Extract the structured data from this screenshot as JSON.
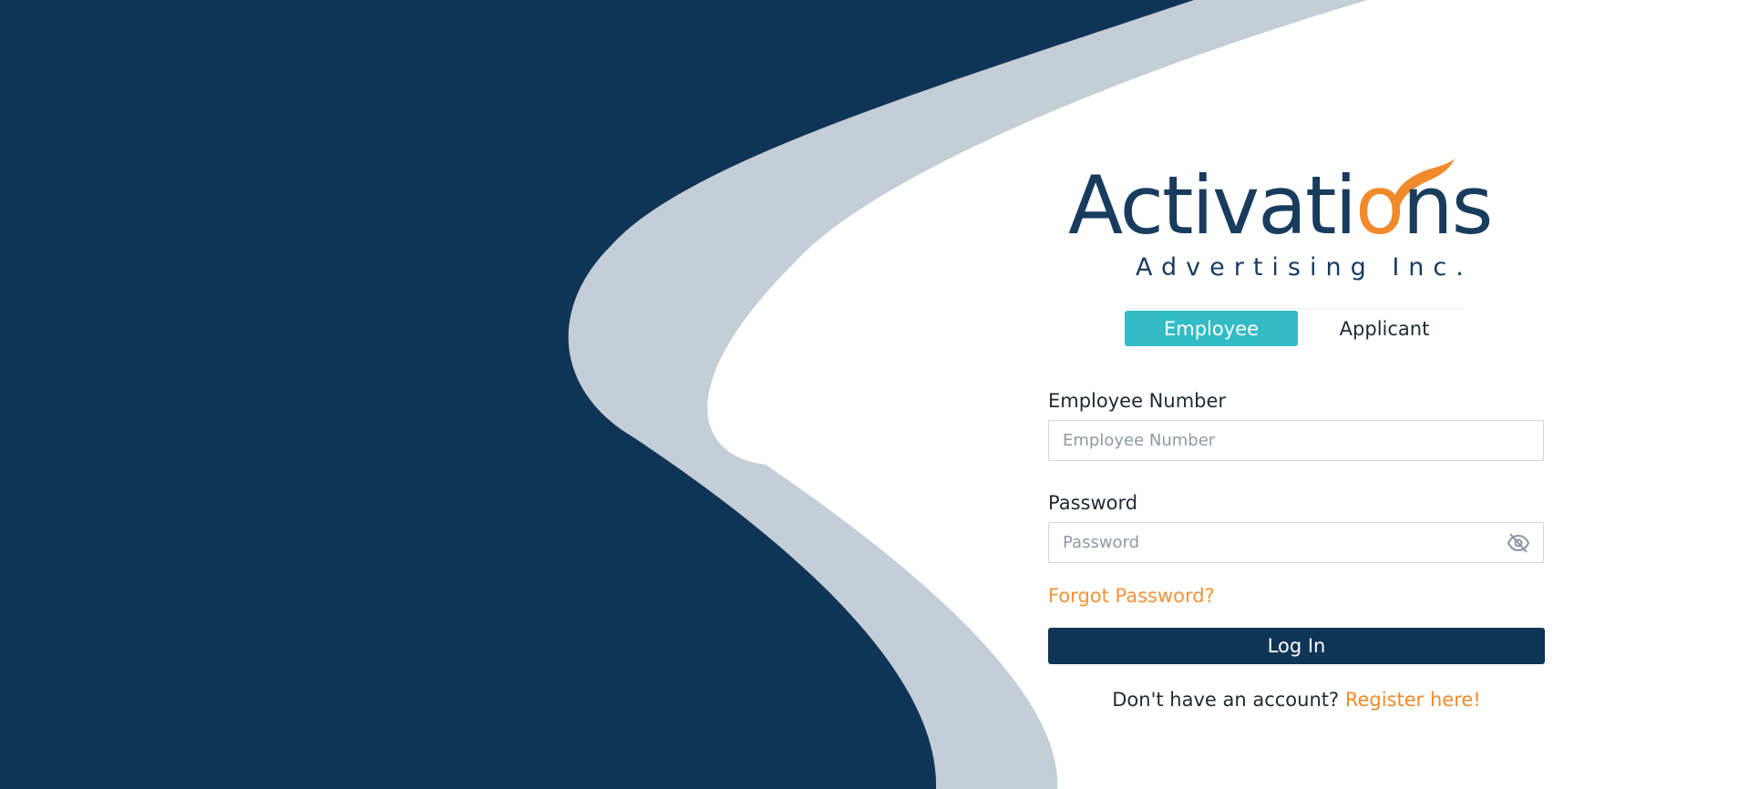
{
  "brand": {
    "logo_word_main": "Activati",
    "logo_word_accent": "o",
    "logo_word_tail": "ns",
    "logo_subtitle": "Advertising Inc.",
    "colors": {
      "navy": "#0f3556",
      "orange": "#f08a2a",
      "teal": "#33bcc6",
      "swoosh": "#c4ced6"
    }
  },
  "tabs": [
    {
      "label": "Employee",
      "active": true
    },
    {
      "label": "Applicant",
      "active": false
    }
  ],
  "form": {
    "employee_number": {
      "label": "Employee Number",
      "placeholder": "Employee Number",
      "value": ""
    },
    "password": {
      "label": "Password",
      "placeholder": "Password",
      "value": "",
      "toggle_icon": "eye-off-icon"
    },
    "forgot_password": "Forgot Password?",
    "login_button": "Log In",
    "register_prompt": "Don't have an account?",
    "register_link": "Register here!"
  }
}
